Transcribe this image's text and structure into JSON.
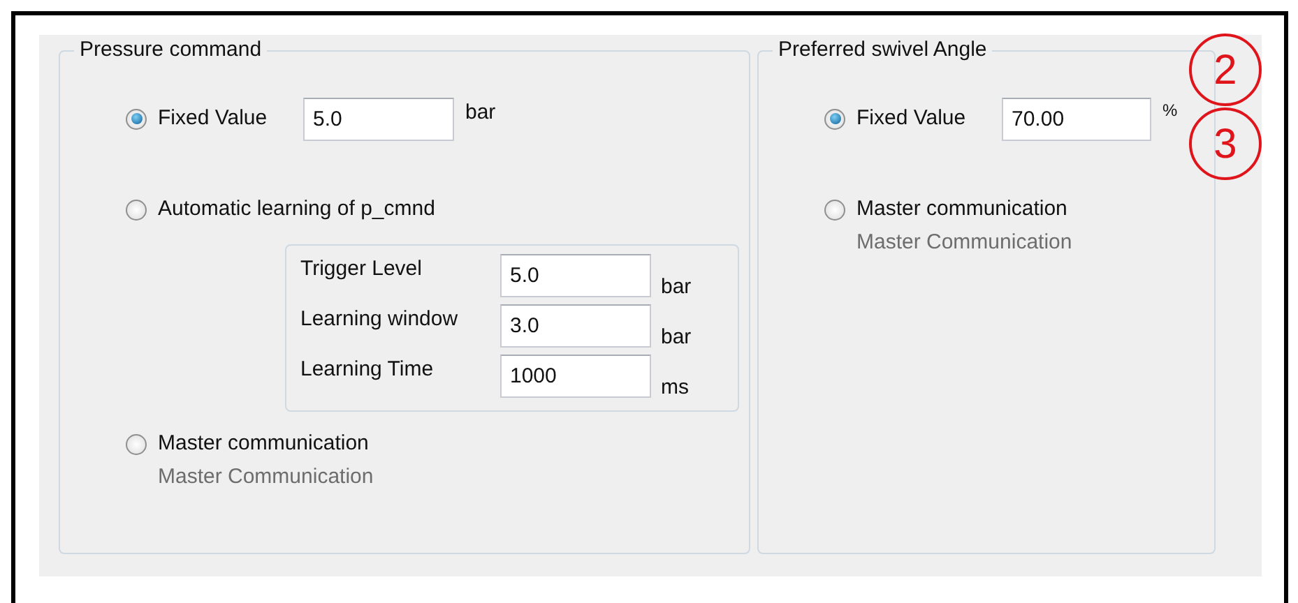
{
  "pressure_command": {
    "title": "Pressure command",
    "options": [
      {
        "kind": "value",
        "label": "Fixed Value",
        "selected": true,
        "value": "5.0",
        "unit": "bar"
      },
      {
        "kind": "learning",
        "label": "Automatic learning of p_cmnd",
        "selected": false,
        "fields": [
          {
            "label": "Trigger Level",
            "value": "5.0",
            "unit": "bar"
          },
          {
            "label": "Learning window",
            "value": "3.0",
            "unit": "bar"
          },
          {
            "label": "Learning Time",
            "value": "1000",
            "unit": "ms"
          }
        ]
      },
      {
        "kind": "master",
        "label": "Master communication",
        "selected": false,
        "note": "Master Communication"
      }
    ]
  },
  "preferred_swivel_angle": {
    "title": "Preferred swivel Angle",
    "options": [
      {
        "kind": "value",
        "label": "Fixed Value",
        "selected": true,
        "value": "70.00",
        "unit": "%"
      },
      {
        "kind": "master",
        "label": "Master communication",
        "selected": false,
        "note": "Master Communication"
      }
    ]
  },
  "callouts": [
    "2",
    "3"
  ]
}
